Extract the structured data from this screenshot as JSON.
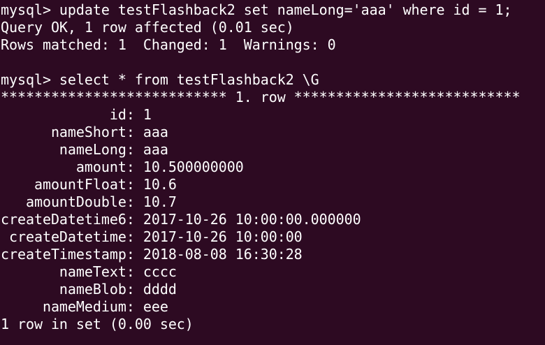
{
  "terminal": {
    "lines": [
      "mysql> update testFlashback2 set nameLong='aaa' where id = 1;",
      "Query OK, 1 row affected (0.01 sec)",
      "Rows matched: 1  Changed: 1  Warnings: 0",
      "",
      "mysql> select * from testFlashback2 \\G",
      "*************************** 1. row ***************************",
      "             id: 1",
      "      nameShort: aaa",
      "       nameLong: aaa",
      "         amount: 10.500000000",
      "    amountFloat: 10.6",
      "   amountDouble: 10.7",
      "createDatetime6: 2017-10-26 10:00:00.000000",
      " createDatetime: 2017-10-26 10:00:00",
      "createTimestamp: 2018-08-08 16:30:28",
      "       nameText: cccc",
      "       nameBlob: dddd",
      "     nameMedium: eee",
      "1 row in set (0.00 sec)"
    ]
  }
}
